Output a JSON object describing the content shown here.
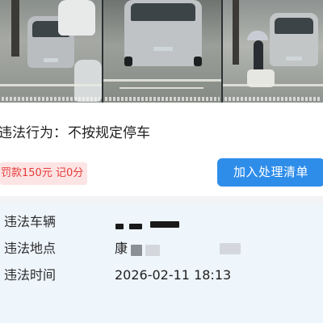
{
  "evidence_photos": {
    "count": 3,
    "items": [
      {
        "name": "photo-1"
      },
      {
        "name": "photo-2"
      },
      {
        "name": "photo-3"
      }
    ]
  },
  "violation": {
    "label": "违法行为：",
    "value": "不按规定停车"
  },
  "fine": {
    "text": "罚款150元 记0分",
    "color": "#e63b3b",
    "background": "#fde4e4"
  },
  "actions": {
    "add_to_list_label": "加入处理清单",
    "button_color": "#2f8dea"
  },
  "details": {
    "vehicle": {
      "label": "违法车辆",
      "value": ""
    },
    "location": {
      "label": "违法地点",
      "value": "康"
    },
    "time": {
      "label": "违法时间",
      "value": "2026-02-11 18:13"
    }
  }
}
